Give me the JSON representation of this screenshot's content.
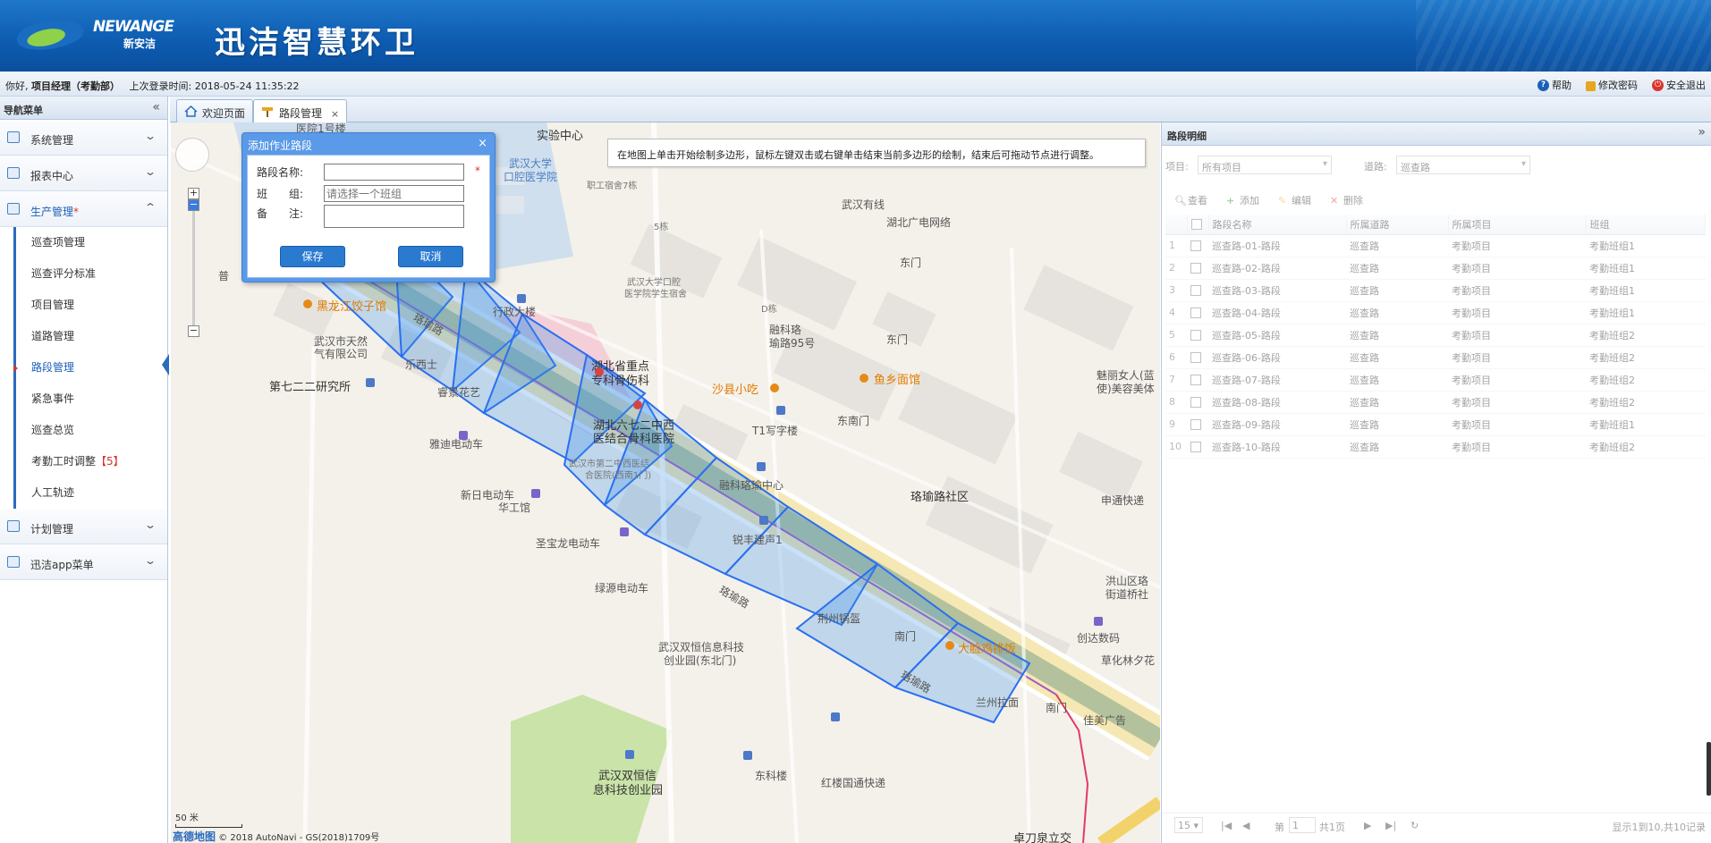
{
  "header": {
    "logo_en": "NEWANGE",
    "logo_cn": "新安洁",
    "app_title": "迅洁智慧环卫"
  },
  "infobar": {
    "greeting": "你好,",
    "user": "项目经理（考勤部）",
    "last_login_label": "上次登录时间:",
    "last_login_time": "2018-05-24 11:35:22",
    "help": "帮助",
    "change_password": "修改密码",
    "logout": "安全退出"
  },
  "sidebar": {
    "title": "导航菜单",
    "groups": [
      {
        "label": "系统管理"
      },
      {
        "label": "报表中心"
      },
      {
        "label": "生产管理",
        "star": "*"
      },
      {
        "label": "计划管理"
      },
      {
        "label": "迅洁app菜单"
      }
    ],
    "sub_items": [
      {
        "label": "巡查项管理"
      },
      {
        "label": "巡查评分标准"
      },
      {
        "label": "项目管理"
      },
      {
        "label": "道路管理"
      },
      {
        "label": "路段管理"
      },
      {
        "label": "紧急事件"
      },
      {
        "label": "巡查总览"
      },
      {
        "label": "考勤工时调整",
        "badge": "【5】"
      },
      {
        "label": "人工轨迹"
      }
    ]
  },
  "tabs": [
    {
      "label": "欢迎页面"
    },
    {
      "label": "路段管理",
      "close": "×"
    }
  ],
  "map": {
    "tip": "在地图上单击开始绘制多边形，鼠标左键双击或右键单击结束当前多边形的绘制，结束后可拖动节点进行调整。",
    "scale": "50 米",
    "brand": "高德地图",
    "copyright": "© 2018 AutoNavi - GS(2018)1709号",
    "labels": {
      "l1": "实验中心",
      "l2": "武汉大学",
      "l3": "口腔医学院",
      "l4": "职工宿舍7栋",
      "l5": "5栋",
      "l6": "武汉有线",
      "l7": "湖北广电网络",
      "l8": "东门",
      "l9": "武汉大学口腔",
      "l10": "医学院学生宿舍",
      "l11": "行政大楼",
      "l12": "黑龙江饺子馆",
      "l13": "武汉市天然",
      "l14": "气有限公司",
      "l15": "乐西士",
      "l16": "第七二二研究所",
      "l17": "睿景花艺",
      "l18": "雅迪电动车",
      "l19": "湖北省重点",
      "l20": "专科骨伤科",
      "l21": "湖北六七二中西",
      "l22": "医结合骨科医院",
      "l23": "武汉市第二中西医结",
      "l24": "合医院(西南1门)",
      "l25": "沙县小吃",
      "l26": "T1写字楼",
      "l27": "融科珞瑜中心",
      "l28": "鱼乡面馆",
      "l29": "东南门",
      "l30": "融科珞",
      "l31": "瑜路95号",
      "l32": "东门",
      "l33": "新日电动车",
      "l34": "华工馆",
      "l35": "圣宝龙电动车",
      "l36": "锐丰建声1",
      "l37": "绿源电动车",
      "l38": "珞瑜路社区",
      "l39": "申通快递",
      "l40": "魅丽女人(蓝",
      "l41": "使)美容美体",
      "l42": "洪山区珞",
      "l43": "街道桥社",
      "l44": "创达数码",
      "l45": "草化林夕花",
      "l46": "荆州锅盔",
      "l47": "南门",
      "l48": "大脸鸡排饭",
      "l49": "武汉双恒信息科技",
      "l50": "创业园(东北门)",
      "l51": "兰州拉面",
      "l52": "南门",
      "l53": "佳美广告",
      "l54": "武汉双恒信",
      "l55": "息科技创业园",
      "l56": "东科楼",
      "l57": "红楼国通快递",
      "l58": "卓刀泉立交",
      "l59": "珞瑜路",
      "l60": "珞瑜路",
      "l61": "珞瑜路",
      "l62": "D栋",
      "l63": "普",
      "l64": "医院1号楼"
    }
  },
  "dialog": {
    "title": "添加作业路段",
    "close": "×",
    "name_label": "路段名称:",
    "name_value": "",
    "required_mark": "*",
    "team_label": "班　　组:",
    "team_placeholder": "请选择一个班组",
    "note_label": "备　　注:",
    "note_value": "",
    "save": "保存",
    "cancel": "取消"
  },
  "right_panel": {
    "title": "路段明细",
    "filter_project_label": "项目:",
    "filter_project_value": "所有项目",
    "filter_road_label": "道路:",
    "filter_road_value": "巡查路",
    "toolbar": {
      "view": "查看",
      "add": "添加",
      "edit": "编辑",
      "delete": "删除"
    },
    "columns": [
      "路段名称",
      "所属道路",
      "所属项目",
      "班组"
    ],
    "rows": [
      {
        "n": "1",
        "name": "巡查路-01-路段",
        "road": "巡查路",
        "project": "考勤项目",
        "team": "考勤班组1"
      },
      {
        "n": "2",
        "name": "巡查路-02-路段",
        "road": "巡查路",
        "project": "考勤项目",
        "team": "考勤班组1"
      },
      {
        "n": "3",
        "name": "巡查路-03-路段",
        "road": "巡查路",
        "project": "考勤项目",
        "team": "考勤班组1"
      },
      {
        "n": "4",
        "name": "巡查路-04-路段",
        "road": "巡查路",
        "project": "考勤项目",
        "team": "考勤班组1"
      },
      {
        "n": "5",
        "name": "巡查路-05-路段",
        "road": "巡查路",
        "project": "考勤项目",
        "team": "考勤班组2"
      },
      {
        "n": "6",
        "name": "巡查路-06-路段",
        "road": "巡查路",
        "project": "考勤项目",
        "team": "考勤班组2"
      },
      {
        "n": "7",
        "name": "巡查路-07-路段",
        "road": "巡查路",
        "project": "考勤项目",
        "team": "考勤班组2"
      },
      {
        "n": "8",
        "name": "巡查路-08-路段",
        "road": "巡查路",
        "project": "考勤项目",
        "team": "考勤班组2"
      },
      {
        "n": "9",
        "name": "巡查路-09-路段",
        "road": "巡查路",
        "project": "考勤项目",
        "team": "考勤班组1"
      },
      {
        "n": "10",
        "name": "巡查路-10-路段",
        "road": "巡查路",
        "project": "考勤项目",
        "team": "考勤班组2"
      }
    ],
    "pager": {
      "page_size": "15",
      "page_prefix": "第",
      "page_value": "1",
      "page_suffix": "共1页",
      "summary": "显示1到10,共10记录"
    }
  }
}
